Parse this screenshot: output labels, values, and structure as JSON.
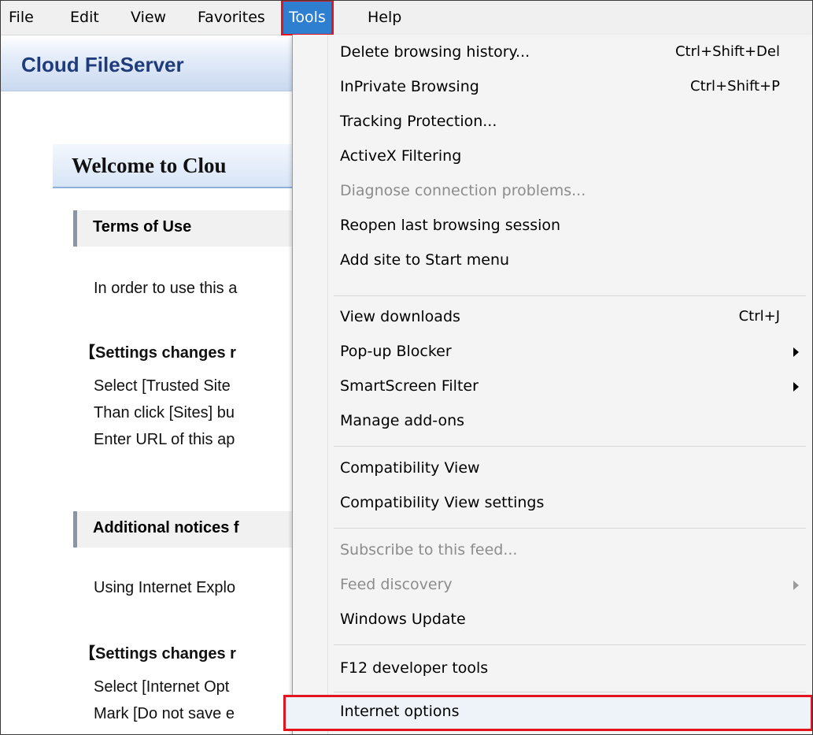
{
  "menubar": {
    "items": [
      {
        "label": "File",
        "active": false
      },
      {
        "label": "Edit",
        "active": false
      },
      {
        "label": "View",
        "active": false
      },
      {
        "label": "Favorites",
        "active": false
      },
      {
        "label": "Tools",
        "active": true
      },
      {
        "label": "Help",
        "active": false
      }
    ]
  },
  "page": {
    "app_title": "Cloud FileServer",
    "welcome": "Welcome to Clou",
    "sections": [
      {
        "heading": "Terms of Use"
      },
      {
        "heading": "Additional notices f"
      }
    ],
    "lines": [
      "In order to use this a",
      "【Settings changes r",
      "Select [Trusted Site",
      "Than click [Sites] bu",
      "Enter URL of this ap",
      "Using Internet Explo",
      "【Settings changes r",
      "Select [Internet Opt",
      "Mark [Do not save e"
    ]
  },
  "tools_menu": {
    "items": [
      {
        "label": "Delete browsing history...",
        "shortcut": "Ctrl+Shift+Del",
        "disabled": false
      },
      {
        "label": "InPrivate Browsing",
        "shortcut": "Ctrl+Shift+P",
        "disabled": false
      },
      {
        "label": "Tracking Protection...",
        "shortcut": "",
        "disabled": false
      },
      {
        "label": "ActiveX Filtering",
        "shortcut": "",
        "disabled": false
      },
      {
        "label": "Diagnose connection problems...",
        "shortcut": "",
        "disabled": true
      },
      {
        "label": "Reopen last browsing session",
        "shortcut": "",
        "disabled": false
      },
      {
        "label": "Add site to Start menu",
        "shortcut": "",
        "disabled": false
      },
      {
        "label": "View downloads",
        "shortcut": "Ctrl+J",
        "disabled": false
      },
      {
        "label": "Pop-up Blocker",
        "shortcut": "",
        "submenu": true,
        "disabled": false
      },
      {
        "label": "SmartScreen Filter",
        "shortcut": "",
        "submenu": true,
        "disabled": false
      },
      {
        "label": "Manage add-ons",
        "shortcut": "",
        "disabled": false
      },
      {
        "label": "Compatibility View",
        "shortcut": "",
        "disabled": false
      },
      {
        "label": "Compatibility View settings",
        "shortcut": "",
        "disabled": false
      },
      {
        "label": "Subscribe to this feed...",
        "shortcut": "",
        "disabled": true
      },
      {
        "label": "Feed discovery",
        "shortcut": "",
        "submenu": true,
        "disabled": true
      },
      {
        "label": "Windows Update",
        "shortcut": "",
        "disabled": false
      },
      {
        "label": "F12 developer tools",
        "shortcut": "",
        "disabled": false
      },
      {
        "label": "Internet options",
        "shortcut": "",
        "disabled": false,
        "highlighted": true
      }
    ]
  },
  "colors": {
    "active_menu_bg": "#2f7fd0",
    "highlight_border": "#e3141e",
    "title_text": "#1f3b7a"
  }
}
